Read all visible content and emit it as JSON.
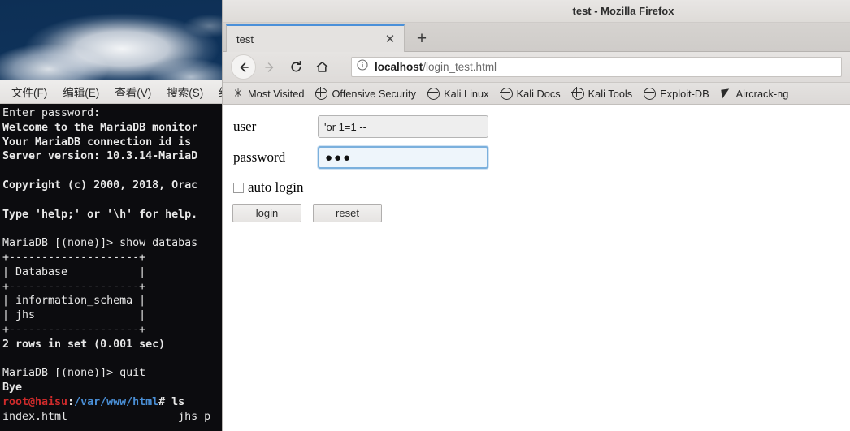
{
  "desktop": {
    "wallpaper_description": "blue sky with clouds",
    "sky_color": "#123a66"
  },
  "terminal": {
    "menu_items": [
      "文件(F)",
      "编辑(E)",
      "查看(V)",
      "搜索(S)",
      "终"
    ],
    "prompt_user_color": "#d02b2b",
    "prompt_path_color": "#4a8fd6",
    "lines": [
      {
        "segments": [
          {
            "text": "Enter password:",
            "style": "normal"
          }
        ]
      },
      {
        "segments": [
          {
            "text": "Welcome to the MariaDB monitor",
            "style": "bold"
          }
        ]
      },
      {
        "segments": [
          {
            "text": "Your MariaDB connection id is",
            "style": "bold"
          }
        ]
      },
      {
        "segments": [
          {
            "text": "Server version: 10.3.14-MariaD",
            "style": "bold"
          }
        ]
      },
      {
        "segments": [
          {
            "text": "",
            "style": "normal"
          }
        ]
      },
      {
        "segments": [
          {
            "text": "Copyright (c) 2000, 2018, Orac",
            "style": "bold"
          }
        ]
      },
      {
        "segments": [
          {
            "text": "",
            "style": "normal"
          }
        ]
      },
      {
        "segments": [
          {
            "text": "Type 'help;' or '\\h' for help.",
            "style": "bold"
          }
        ]
      },
      {
        "segments": [
          {
            "text": "",
            "style": "normal"
          }
        ]
      },
      {
        "segments": [
          {
            "text": "MariaDB [(none)]> show databas",
            "style": "normal"
          }
        ]
      },
      {
        "segments": [
          {
            "text": "+--------------------+",
            "style": "normal"
          }
        ]
      },
      {
        "segments": [
          {
            "text": "| Database           |",
            "style": "normal"
          }
        ]
      },
      {
        "segments": [
          {
            "text": "+--------------------+",
            "style": "normal"
          }
        ]
      },
      {
        "segments": [
          {
            "text": "| information_schema |",
            "style": "normal"
          }
        ]
      },
      {
        "segments": [
          {
            "text": "| jhs                |",
            "style": "normal"
          }
        ]
      },
      {
        "segments": [
          {
            "text": "+--------------------+",
            "style": "normal"
          }
        ]
      },
      {
        "segments": [
          {
            "text": "2 rows in set (0.001 sec)",
            "style": "bold"
          }
        ]
      },
      {
        "segments": [
          {
            "text": "",
            "style": "normal"
          }
        ]
      },
      {
        "segments": [
          {
            "text": "MariaDB [(none)]> quit",
            "style": "normal"
          }
        ]
      },
      {
        "segments": [
          {
            "text": "Bye",
            "style": "bold"
          }
        ]
      },
      {
        "segments": [
          {
            "text": "root@haisu",
            "style": "red"
          },
          {
            "text": ":",
            "style": "white"
          },
          {
            "text": "/var/www/html",
            "style": "blue"
          },
          {
            "text": "# ls",
            "style": "white"
          }
        ]
      },
      {
        "segments": [
          {
            "text": "index.html                 jhs p",
            "style": "normal"
          }
        ]
      }
    ]
  },
  "browser": {
    "window_title": "test - Mozilla Firefox",
    "tab": {
      "label": "test",
      "close_glyph": "✕",
      "active_indicator_color": "#4a90d9"
    },
    "new_tab_glyph": "+",
    "nav": {
      "back_glyph": "←",
      "forward_glyph": "→",
      "reload_glyph": "⟳",
      "home_glyph": "⌂"
    },
    "urlbar": {
      "identity_glyph": "ⓘ",
      "host": "localhost",
      "path": "/login_test.html"
    },
    "bookmarks": [
      {
        "label": "Most Visited",
        "icon": "gear-icon"
      },
      {
        "label": "Offensive Security",
        "icon": "globe-icon"
      },
      {
        "label": "Kali Linux",
        "icon": "globe-icon"
      },
      {
        "label": "Kali Docs",
        "icon": "globe-icon"
      },
      {
        "label": "Kali Tools",
        "icon": "globe-icon"
      },
      {
        "label": "Exploit-DB",
        "icon": "globe-icon"
      },
      {
        "label": "Aircrack-ng",
        "icon": "aircrack-icon"
      }
    ]
  },
  "page": {
    "fields": [
      {
        "label": "user",
        "value": "'or 1=1 --",
        "type": "text",
        "focused": false
      },
      {
        "label": "password",
        "value": "●●●",
        "type": "password",
        "focused": true
      }
    ],
    "checkbox": {
      "label": "auto login",
      "checked": false
    },
    "buttons": [
      {
        "label": "login"
      },
      {
        "label": "reset"
      }
    ]
  }
}
